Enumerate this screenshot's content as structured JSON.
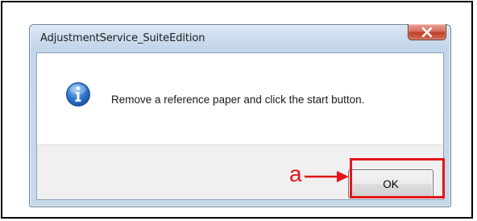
{
  "dialog": {
    "title": "AdjustmentService_SuiteEdition",
    "close_icon": "close-icon",
    "message_icon": "information-icon",
    "message": "Remove a reference paper and click the start button.",
    "ok_label": "OK"
  },
  "annotation": {
    "label": "a",
    "color": "#e3151b"
  },
  "colors": {
    "frame": "#000000",
    "titlebar": "#c9daec",
    "close_button": "#c94a34",
    "button_area": "#f0f0f0"
  }
}
